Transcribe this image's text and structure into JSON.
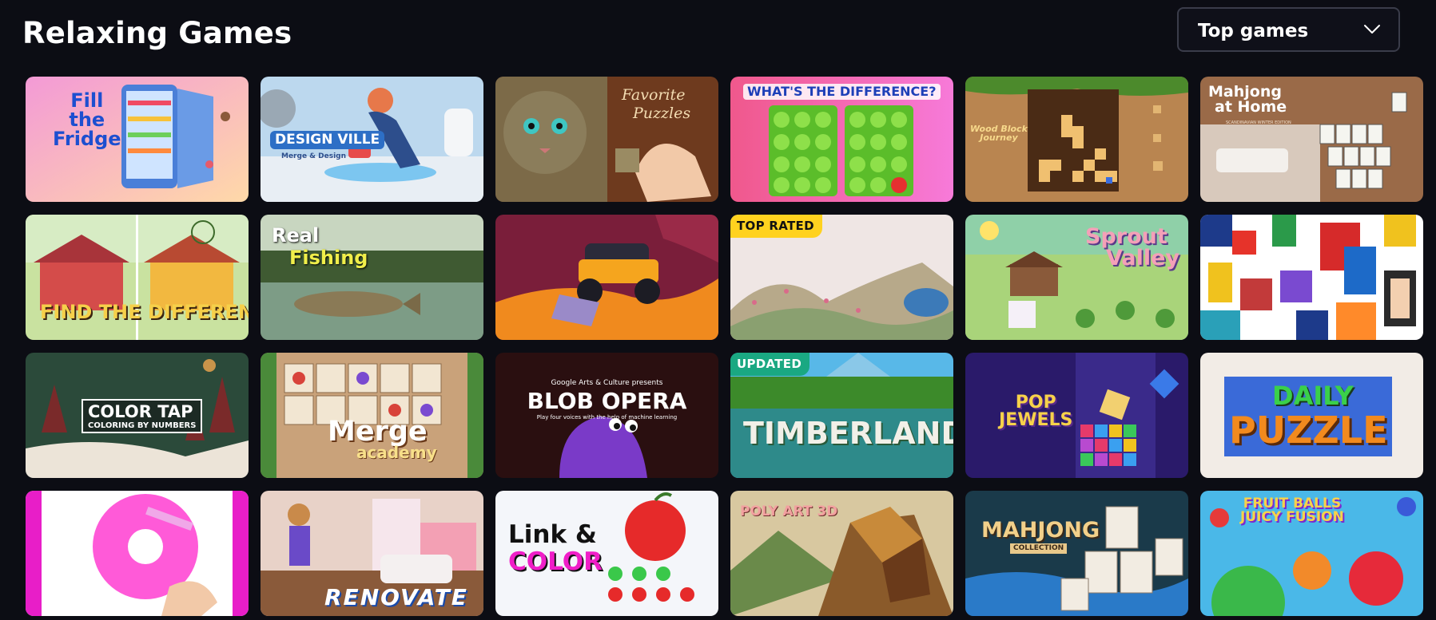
{
  "page": {
    "title": "Relaxing Games"
  },
  "sort": {
    "selected": "Top games",
    "icon": "chevron-down-icon"
  },
  "games": [
    {
      "title": "Fill the Fridge",
      "art": [
        "Fill",
        "the",
        "Fridge"
      ]
    },
    {
      "title": "Design Ville",
      "art": [
        "DESIGN VILLE",
        "Merge & Design"
      ]
    },
    {
      "title": "Favorite Puzzles",
      "art": [
        "Favorite",
        "Puzzles"
      ]
    },
    {
      "title": "What's the Difference?",
      "art": [
        "WHAT'S THE DIFFERENCE?"
      ]
    },
    {
      "title": "Wood Block Journey",
      "art": [
        "Wood Block",
        "Journey"
      ]
    },
    {
      "title": "Mahjong at Home",
      "art": [
        "Mahjong",
        "at Home",
        "SCANDINAVIAN WINTER EDITION"
      ]
    },
    {
      "title": "Find the Difference",
      "art": [
        "FIND THE DIFFERENCE"
      ]
    },
    {
      "title": "Real Fishing",
      "art": [
        "Real",
        "Fishing"
      ]
    },
    {
      "title": "Monster Truck",
      "art": []
    },
    {
      "title": "Flower Garden",
      "art": [],
      "badge": "TOP RATED"
    },
    {
      "title": "Sprout Valley",
      "art": [
        "Sprout",
        "Valley"
      ]
    },
    {
      "title": "Pixel Art",
      "art": []
    },
    {
      "title": "Color Tap",
      "art": [
        "COLOR TAP",
        "COLORING BY NUMBERS"
      ]
    },
    {
      "title": "Merge Academy",
      "art": [
        "Merge",
        "academy"
      ]
    },
    {
      "title": "Blob Opera",
      "art": [
        "Google Arts & Culture presents",
        "BLOB OPERA",
        "Play four voices with the help of machine learning"
      ]
    },
    {
      "title": "Timberland",
      "art": [
        "TIMBERLAND"
      ],
      "badge": "UPDATED"
    },
    {
      "title": "Pop Jewels",
      "art": [
        "POP",
        "JEWELS"
      ]
    },
    {
      "title": "Daily Puzzle",
      "art": [
        "DAILY",
        "PUZZLE"
      ]
    },
    {
      "title": "Color by Number Donut",
      "art": []
    },
    {
      "title": "Renovate",
      "art": [
        "RENOVATE"
      ]
    },
    {
      "title": "Link & Color",
      "art": [
        "Link &",
        "COLOR"
      ]
    },
    {
      "title": "Poly Art 3D",
      "art": [
        "POLY ART 3D"
      ]
    },
    {
      "title": "Mahjong Collection",
      "art": [
        "MAHJONG",
        "COLLECTION"
      ]
    },
    {
      "title": "Fruit Balls Juicy Fusion",
      "art": [
        "FRUIT BALLS",
        "JUICY FUSION"
      ]
    }
  ]
}
